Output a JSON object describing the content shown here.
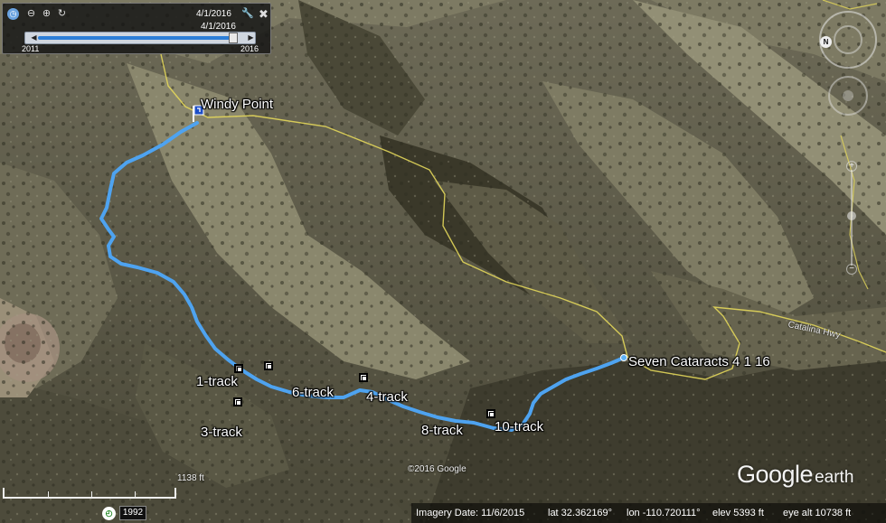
{
  "time_slider": {
    "current_date": "4/1/2016",
    "end_date_label": "4/1/2016",
    "start_year": "2011",
    "end_year": "2016",
    "position_fraction": 0.98
  },
  "icons": {
    "clock": "clock-icon",
    "zoom_out": "zoom-out-icon",
    "zoom_in": "zoom-in-icon",
    "loop": "loop-icon",
    "settings": "wrench-icon",
    "close": "close-icon",
    "compass_north": "N"
  },
  "places": {
    "windy_point": "Windy Point",
    "seven_cataracts": "Seven Cataracts 4 1 16",
    "road": "Catalina Hwy"
  },
  "waypoints": [
    {
      "label": "1-track"
    },
    {
      "label": "3-track"
    },
    {
      "label": "4-track"
    },
    {
      "label": "6-track"
    },
    {
      "label": "8-track"
    },
    {
      "label": "10-track"
    }
  ],
  "copyright": "©2016 Google",
  "scale": {
    "label": "1138 ft"
  },
  "logo": {
    "google": "Google",
    "earth": "earth"
  },
  "historical_imagery": {
    "year": "1992"
  },
  "status": {
    "imagery_date": "Imagery Date: 11/6/2015",
    "lat": "lat   32.362169°",
    "lon": "lon  -110.720111°",
    "elev": "elev   5393 ft",
    "eye_alt": "eye alt  10738 ft"
  },
  "colors": {
    "track": "#4ea3f0",
    "road": "#e2d65a",
    "terrain_dark": "#3b3a2b",
    "terrain_light": "#8c8a72"
  }
}
